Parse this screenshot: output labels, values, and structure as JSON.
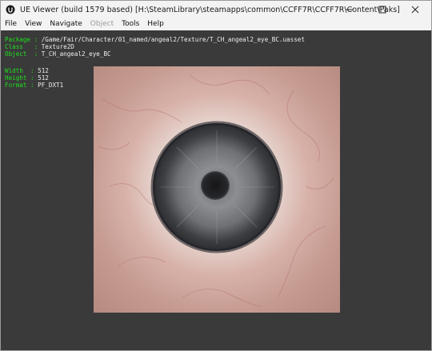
{
  "window": {
    "title": "UE Viewer (build 1579 based) [H:\\SteamLibrary\\steamapps\\common\\CCFF7R\\CCFF7R\\Content\\Paks]",
    "app_icon": "ue-logo-icon",
    "controls": [
      "minimize-icon",
      "maximize-icon",
      "close-icon"
    ]
  },
  "menu": [
    {
      "label": "File",
      "enabled": true
    },
    {
      "label": "View",
      "enabled": true
    },
    {
      "label": "Navigate",
      "enabled": true
    },
    {
      "label": "Object",
      "enabled": false
    },
    {
      "label": "Tools",
      "enabled": true
    },
    {
      "label": "Help",
      "enabled": true
    }
  ],
  "object_info": {
    "package_label": "Package",
    "package_value": "/Game/Fair/Character/01_named/angeal2/Texture/T_CH_angeal2_eye_BC.uasset",
    "class_label": "Class",
    "class_value": "Texture2D",
    "object_label": "Object",
    "object_value": "T_CH_angeal2_eye_BC"
  },
  "texture_info": {
    "width_label": "Width",
    "width_value": "512",
    "height_label": "Height",
    "height_value": "512",
    "format_label": "Format",
    "format_value": "PF_DXT1"
  },
  "colors": {
    "viewport_bg": "#3a3a3a",
    "label_green": "#1ee01e",
    "value_text": "#eeeeee"
  }
}
